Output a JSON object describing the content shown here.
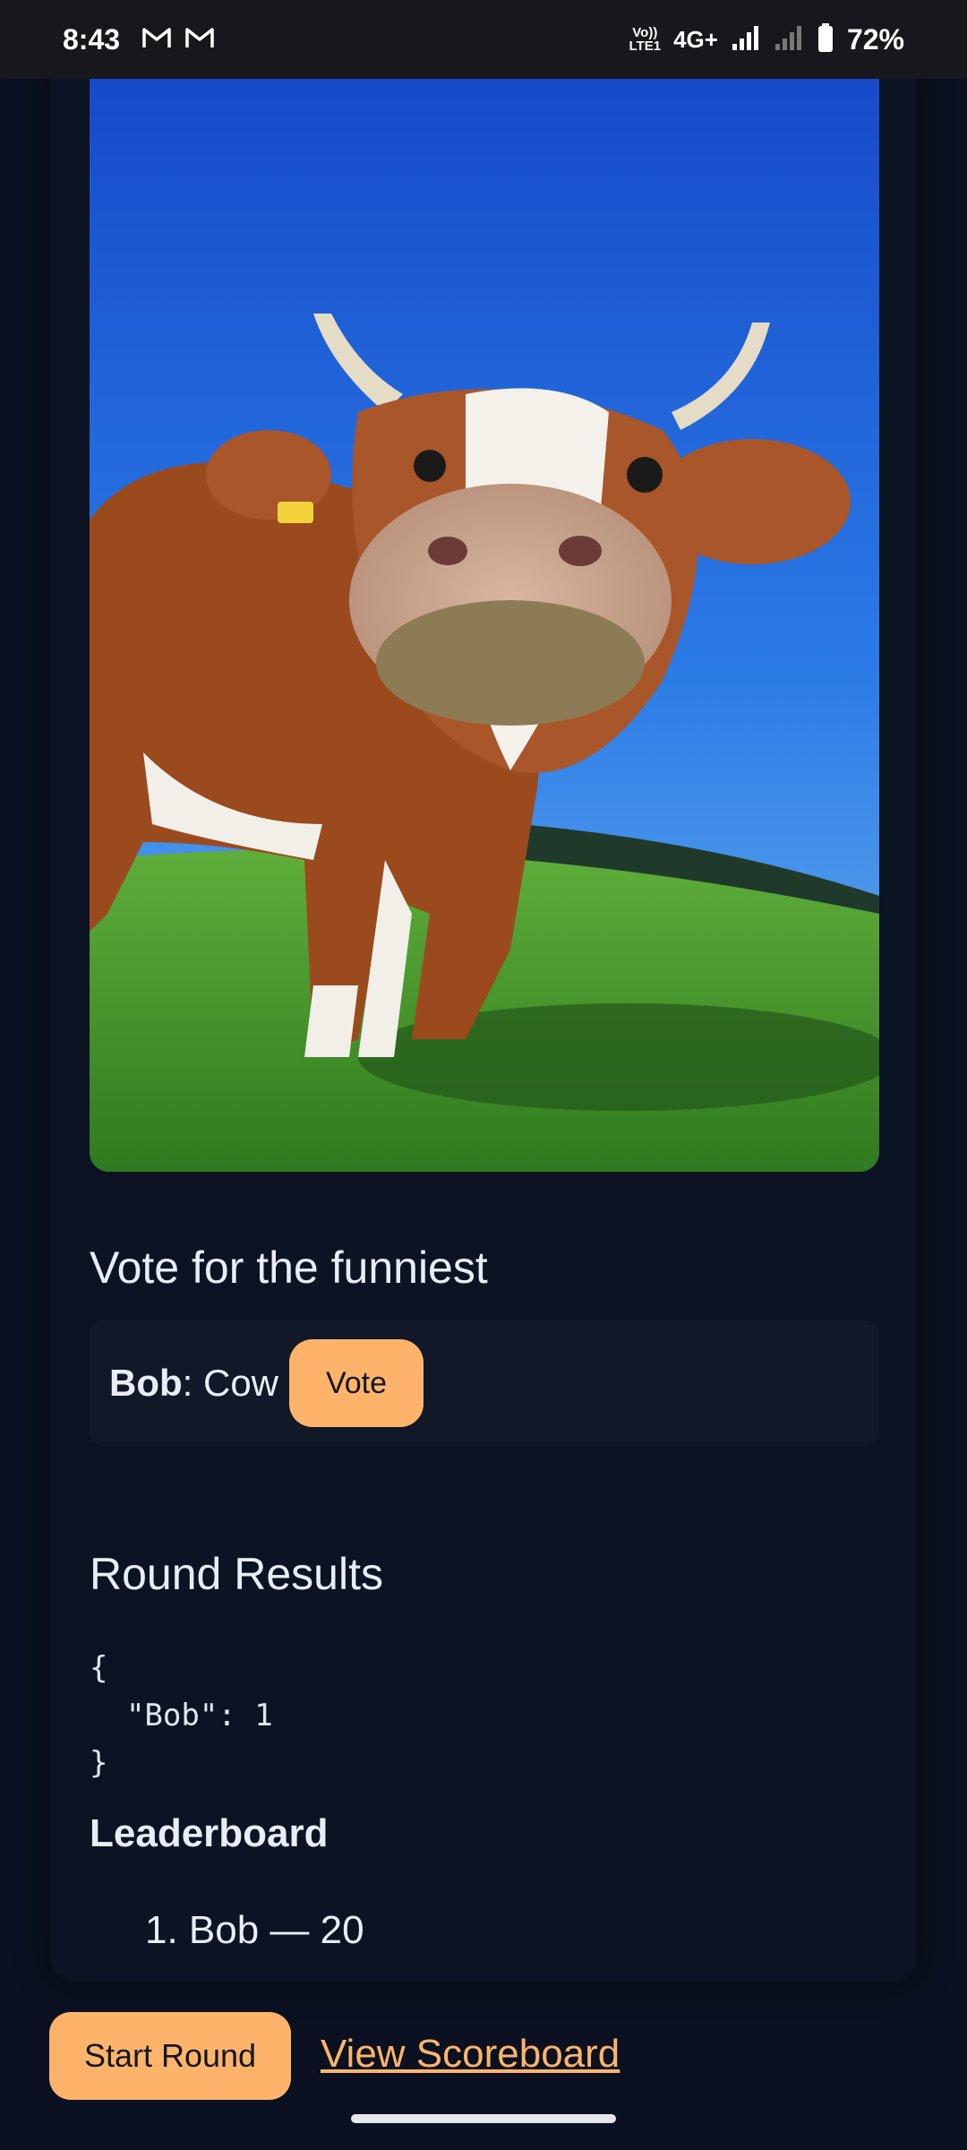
{
  "status_bar": {
    "time": "8:43",
    "mail_icons": [
      "gmail-icon",
      "gmail-icon"
    ],
    "volte": "Vo)) LTE1",
    "network": "4G+",
    "battery": "72%"
  },
  "image": {
    "alt_subject": "cow",
    "icon": "photo-cow"
  },
  "vote": {
    "heading": "Vote for the funniest",
    "option": {
      "player": "Bob",
      "caption": ": Cow",
      "button_label": "Vote"
    }
  },
  "results": {
    "heading": "Round Results",
    "json_text": "{\n  \"Bob\": 1\n}"
  },
  "leaderboard": {
    "heading": "Leaderboard",
    "entries": [
      "1. Bob — 20"
    ]
  },
  "actions": {
    "start_label": "Start Round",
    "scoreboard_label": "View Scoreboard"
  },
  "colors": {
    "background": "#0b1120",
    "card": "#0c1322",
    "accent": "#fdb46a"
  }
}
